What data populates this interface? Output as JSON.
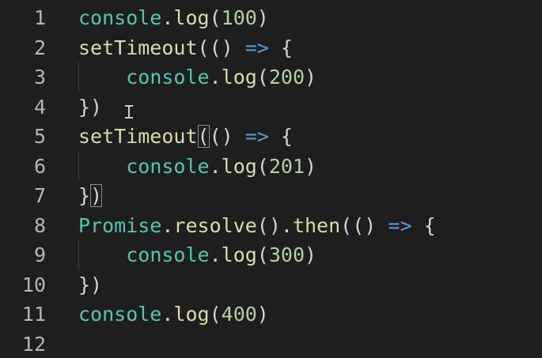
{
  "editor": {
    "lines": [
      {
        "num": "1",
        "tokens": [
          [
            "console",
            "cls"
          ],
          [
            ".",
            "p"
          ],
          [
            "log",
            "fn"
          ],
          [
            "(",
            "p"
          ],
          [
            "100",
            "num"
          ],
          [
            ")",
            "p"
          ]
        ]
      },
      {
        "num": "2",
        "tokens": [
          [
            "setTimeout",
            "fn"
          ],
          [
            "(",
            "p"
          ],
          [
            "()",
            "p"
          ],
          [
            " ",
            "p"
          ],
          [
            "=>",
            "kw"
          ],
          [
            " ",
            "p"
          ],
          [
            "{",
            "p"
          ]
        ]
      },
      {
        "num": "3",
        "indent": true,
        "tokens": [
          [
            "    ",
            "p"
          ],
          [
            "console",
            "cls"
          ],
          [
            ".",
            "p"
          ],
          [
            "log",
            "fn"
          ],
          [
            "(",
            "p"
          ],
          [
            "200",
            "num"
          ],
          [
            ")",
            "p"
          ]
        ]
      },
      {
        "num": "4",
        "tokens": [
          [
            "})",
            "p"
          ]
        ]
      },
      {
        "num": "5",
        "tokens": [
          [
            "setTimeout",
            "fn"
          ],
          [
            "(",
            "pb"
          ],
          [
            "()",
            "p"
          ],
          [
            " ",
            "p"
          ],
          [
            "=>",
            "kw"
          ],
          [
            " ",
            "p"
          ],
          [
            "{",
            "p"
          ]
        ]
      },
      {
        "num": "6",
        "indent": true,
        "tokens": [
          [
            "    ",
            "p"
          ],
          [
            "console",
            "cls"
          ],
          [
            ".",
            "p"
          ],
          [
            "log",
            "fn"
          ],
          [
            "(",
            "p"
          ],
          [
            "201",
            "num"
          ],
          [
            ")",
            "p"
          ]
        ]
      },
      {
        "num": "7",
        "tokens": [
          [
            "}",
            "p"
          ],
          [
            ")",
            "pb"
          ]
        ]
      },
      {
        "num": "8",
        "tokens": [
          [
            "Promise",
            "cls"
          ],
          [
            ".",
            "p"
          ],
          [
            "resolve",
            "fn"
          ],
          [
            "()",
            "p"
          ],
          [
            ".",
            "p"
          ],
          [
            "then",
            "fn"
          ],
          [
            "(",
            "p"
          ],
          [
            "()",
            "p"
          ],
          [
            " ",
            "p"
          ],
          [
            "=>",
            "kw"
          ],
          [
            " ",
            "p"
          ],
          [
            "{",
            "p"
          ]
        ]
      },
      {
        "num": "9",
        "indent": true,
        "tokens": [
          [
            "    ",
            "p"
          ],
          [
            "console",
            "cls"
          ],
          [
            ".",
            "p"
          ],
          [
            "log",
            "fn"
          ],
          [
            "(",
            "p"
          ],
          [
            "300",
            "num"
          ],
          [
            ")",
            "p"
          ]
        ]
      },
      {
        "num": "10",
        "tokens": [
          [
            "})",
            "p"
          ]
        ]
      },
      {
        "num": "11",
        "tokens": [
          [
            "console",
            "cls"
          ],
          [
            ".",
            "p"
          ],
          [
            "log",
            "fn"
          ],
          [
            "(",
            "p"
          ],
          [
            "400",
            "num"
          ],
          [
            ")",
            "p"
          ]
        ]
      },
      {
        "num": "12",
        "tokens": []
      }
    ]
  },
  "colors": {
    "background": "#1e1e1e",
    "line_number": "#b5b5b5",
    "class_name": "#4ec9b0",
    "function": "#dcdcaa",
    "number": "#b5cea8",
    "keyword": "#569cd6",
    "punctuation": "#d4d4d4"
  },
  "cursor": {
    "icon": "text-cursor-icon"
  }
}
